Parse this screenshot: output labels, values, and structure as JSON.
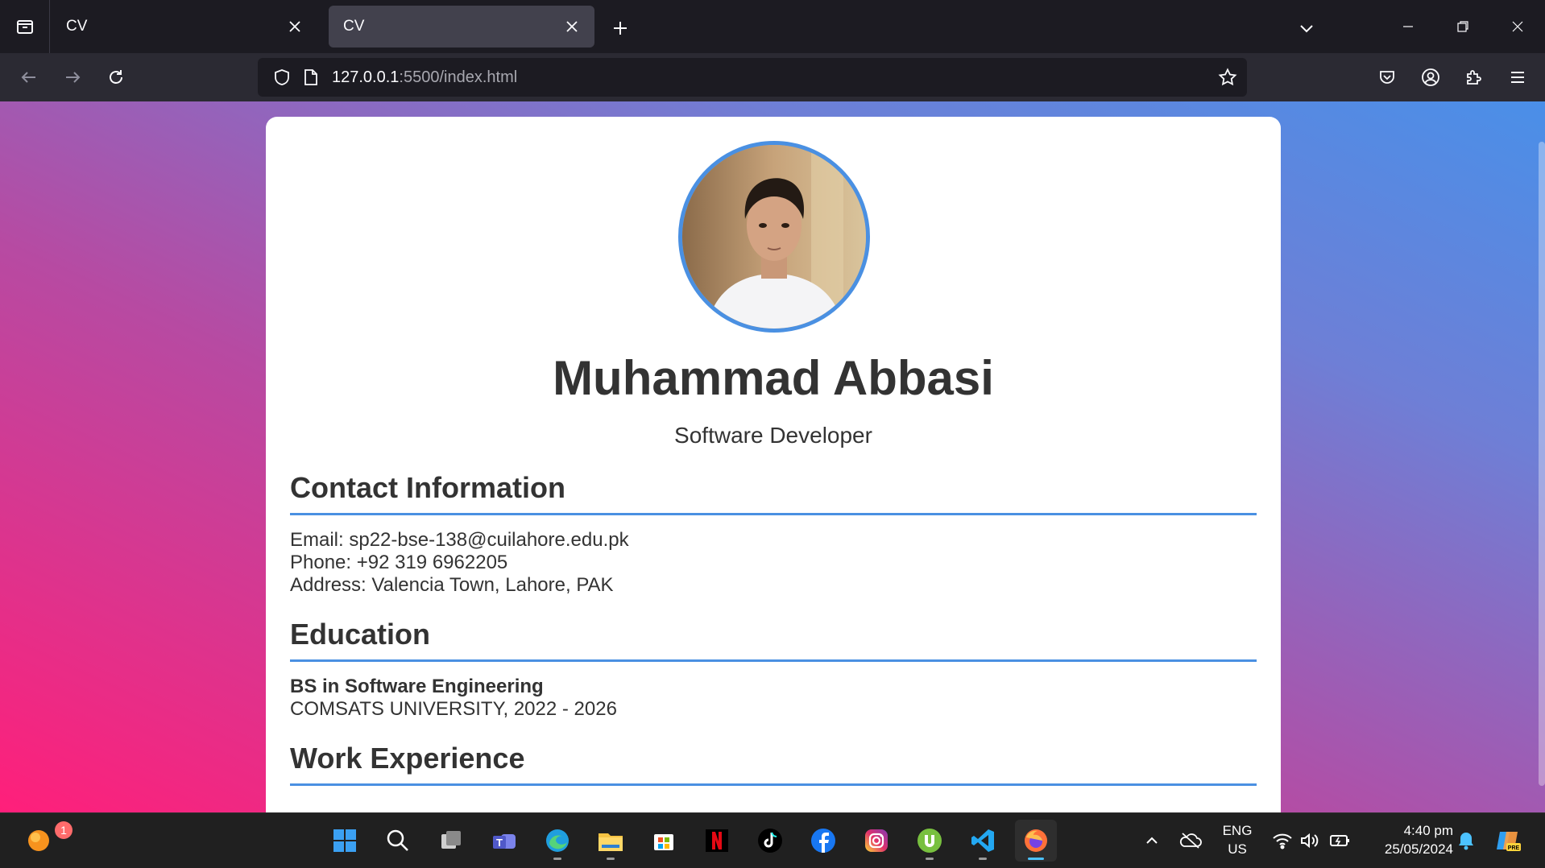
{
  "browser": {
    "tabs": [
      {
        "title": "CV",
        "active": false
      },
      {
        "title": "CV",
        "active": true
      }
    ],
    "url_host": "127.0.0.1",
    "url_path": ":5500/index.html"
  },
  "cv": {
    "name": "Muhammad Abbasi",
    "role": "Software Developer",
    "sections": {
      "contact_title": "Contact Information",
      "email": "Email: sp22-bse-138@cuilahore.edu.pk",
      "phone": "Phone: +92 319 6962205",
      "address": "Address: Valencia Town, Lahore, PAK",
      "education_title": "Education",
      "degree": "BS in Software Engineering",
      "school": "COMSATS UNIVERSITY, 2022 - 2026",
      "work_title": "Work Experience"
    },
    "accent_color": "#4a90e2"
  },
  "taskbar": {
    "notification_badge": "1",
    "language_line1": "ENG",
    "language_line2": "US",
    "time": "4:40 pm",
    "date": "25/05/2024",
    "apps": [
      "start-icon",
      "search-icon",
      "task-view-icon",
      "teams-icon",
      "edge-icon",
      "file-explorer-icon",
      "store-icon",
      "netflix-icon",
      "tiktok-icon",
      "facebook-icon",
      "instagram-icon",
      "utorrent-icon",
      "vscode-icon",
      "firefox-icon"
    ]
  }
}
